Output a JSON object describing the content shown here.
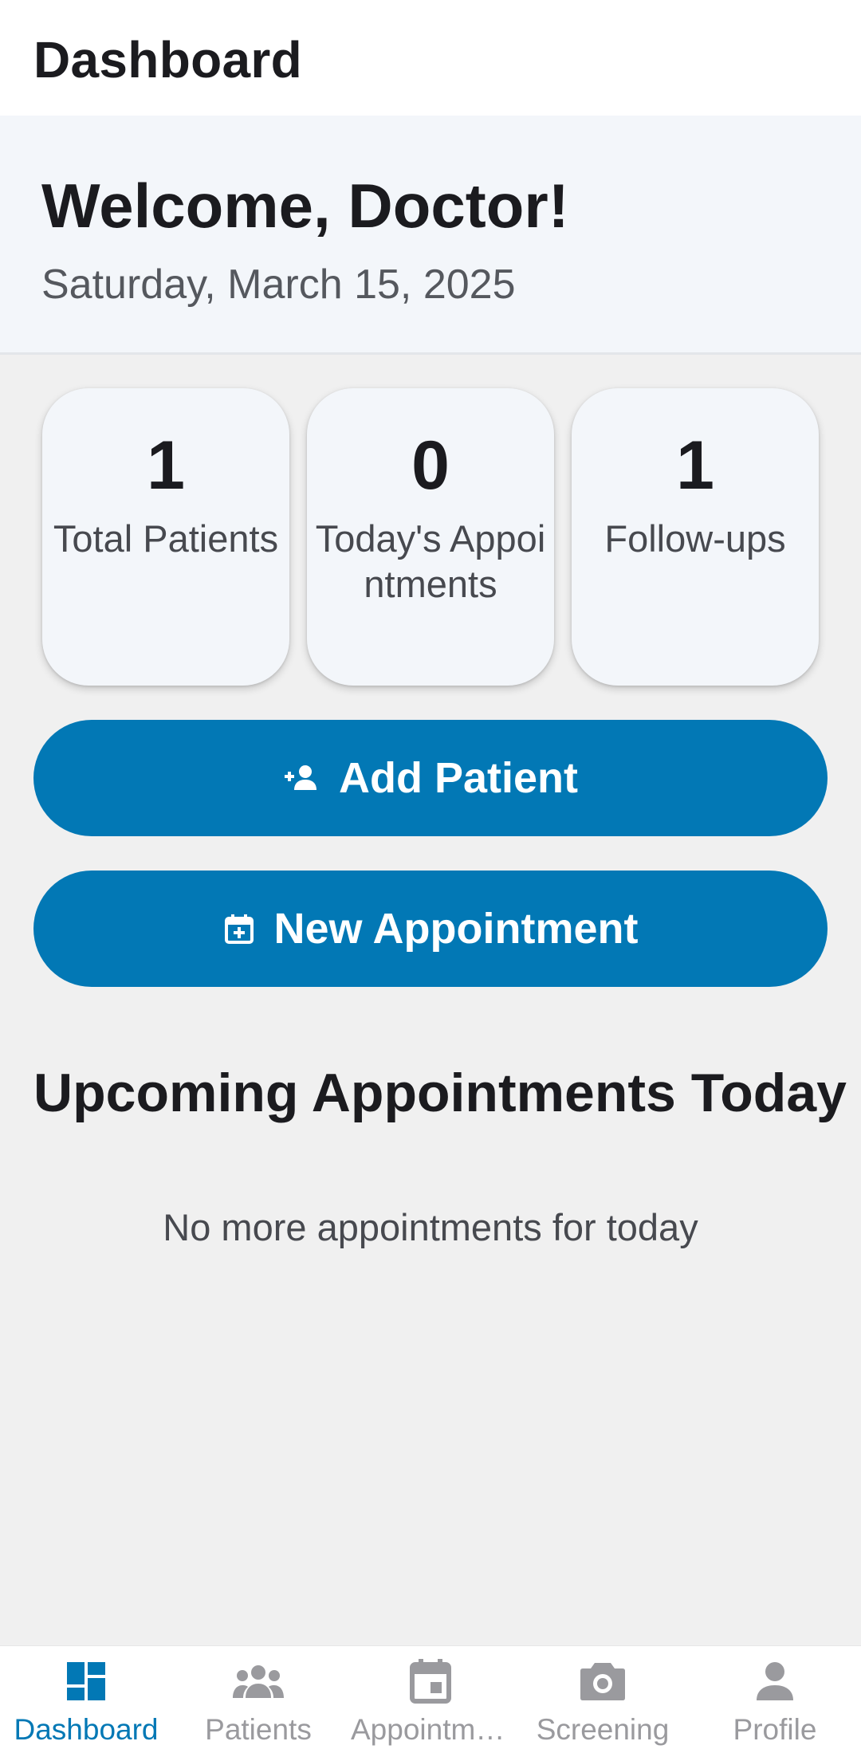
{
  "header": {
    "title": "Dashboard"
  },
  "welcome": {
    "title": "Welcome, Doctor!",
    "date": "Saturday, March 15, 2025"
  },
  "stats": [
    {
      "value": "1",
      "label": "Total Patients"
    },
    {
      "value": "0",
      "label": "Today's Appointments"
    },
    {
      "value": "1",
      "label": "Follow-ups"
    }
  ],
  "actions": {
    "add_patient": {
      "label": "Add Patient",
      "icon": "person-add-icon"
    },
    "new_appointment": {
      "label": "New Appointment",
      "icon": "calendar-plus-icon"
    }
  },
  "upcoming": {
    "title": "Upcoming Appointments Today",
    "empty_message": "No more appointments for today"
  },
  "bottom_nav": {
    "active": "Dashboard",
    "items": [
      {
        "label": "Dashboard",
        "icon": "dashboard-icon"
      },
      {
        "label": "Patients",
        "icon": "people-icon"
      },
      {
        "label": "Appointments",
        "icon": "calendar-icon"
      },
      {
        "label": "Screening",
        "icon": "camera-icon"
      },
      {
        "label": "Profile",
        "icon": "person-icon"
      }
    ]
  },
  "colors": {
    "primary": "#0278b5",
    "inactive": "#9a9a9e",
    "text": "#1b1b1f"
  }
}
